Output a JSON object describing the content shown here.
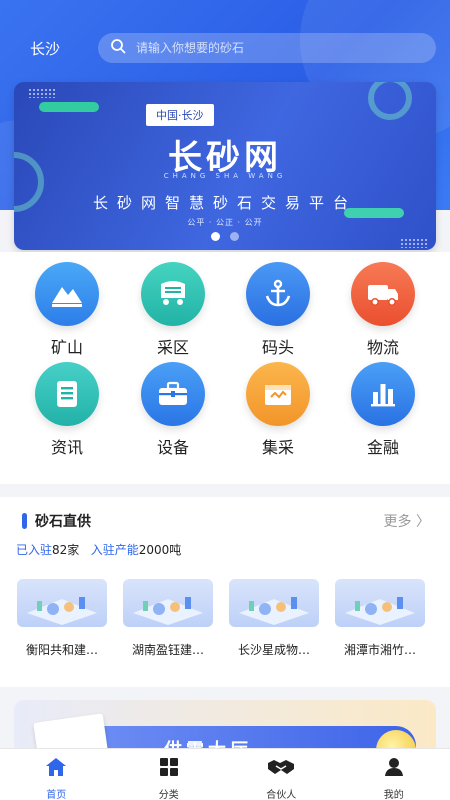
{
  "header": {
    "city": "长沙",
    "search_placeholder": "请输入你想要的砂石"
  },
  "banner": {
    "tag": "中国·长沙",
    "title": "长砂网",
    "pinyin": "CHANG SHA WANG",
    "slogan": "长砂网智慧砂石交易平台",
    "sub": "公平 · 公正 · 公开",
    "slides": 2,
    "active_slide": 1
  },
  "categories": [
    {
      "label": "矿山",
      "icon": "mountain-icon",
      "color": "#2d8ff0"
    },
    {
      "label": "采区",
      "icon": "mining-truck-icon",
      "color": "#2fc3b2"
    },
    {
      "label": "码头",
      "icon": "anchor-icon",
      "color": "#2d7fe8"
    },
    {
      "label": "物流",
      "icon": "delivery-truck-icon",
      "color": "#f0603c"
    },
    {
      "label": "资讯",
      "icon": "document-icon",
      "color": "#2bc0b6"
    },
    {
      "label": "设备",
      "icon": "toolbox-icon",
      "color": "#2a86ee"
    },
    {
      "label": "集采",
      "icon": "package-icon",
      "color": "#f5a23a"
    },
    {
      "label": "金融",
      "icon": "bar-chart-icon",
      "color": "#2f7fea"
    }
  ],
  "supply": {
    "title": "砂石直供",
    "more": "更多 〉",
    "settled_label": "已入驻",
    "settled_value": "82家",
    "capacity_label": "入驻产能",
    "capacity_value": "2000吨",
    "items": [
      {
        "name": "衡阳共和建…"
      },
      {
        "name": "湖南盈钰建…"
      },
      {
        "name": "长沙星成物…"
      },
      {
        "name": "湘潭市湘竹…"
      }
    ]
  },
  "promo": {
    "text": "供需大厅"
  },
  "tabbar": {
    "tabs": [
      {
        "label": "首页",
        "icon": "home-icon",
        "active": true
      },
      {
        "label": "分类",
        "icon": "category-grid-icon",
        "active": false
      },
      {
        "label": "合伙人",
        "icon": "handshake-icon",
        "active": false
      },
      {
        "label": "我的",
        "icon": "profile-icon",
        "active": false
      }
    ]
  },
  "colors": {
    "primary": "#2f66ea",
    "header": "#3a73f0"
  }
}
